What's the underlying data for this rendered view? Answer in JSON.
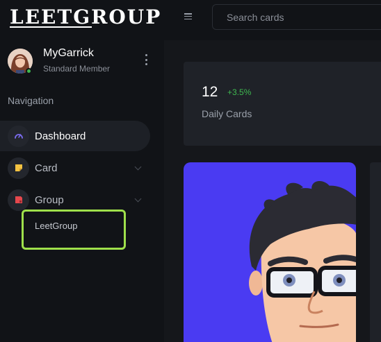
{
  "app": {
    "logo_text": "LEETGROUP"
  },
  "topbar": {
    "search_placeholder": "Search cards"
  },
  "profile": {
    "name": "MyGarrick",
    "role": "Standard Member",
    "status": "online"
  },
  "navigation": {
    "title": "Navigation",
    "items": [
      {
        "label": "Dashboard",
        "icon": "gauge-icon",
        "active": true
      },
      {
        "label": "Card",
        "icon": "note-icon",
        "expandable": true
      },
      {
        "label": "Group",
        "icon": "bookmark-icon",
        "expandable": true,
        "expanded": true,
        "children": [
          {
            "label": "LeetGroup"
          }
        ]
      }
    ]
  },
  "stats": {
    "value": "12",
    "change": "+3.5%",
    "label": "Daily Cards"
  },
  "colors": {
    "accent_purple": "#6c5dd3",
    "card_yellow": "#f5c342",
    "group_red": "#e5484d",
    "positive_green": "#3fb950",
    "highlight_green": "#9fe04b",
    "card_bg_blue": "#4a3bf2"
  }
}
